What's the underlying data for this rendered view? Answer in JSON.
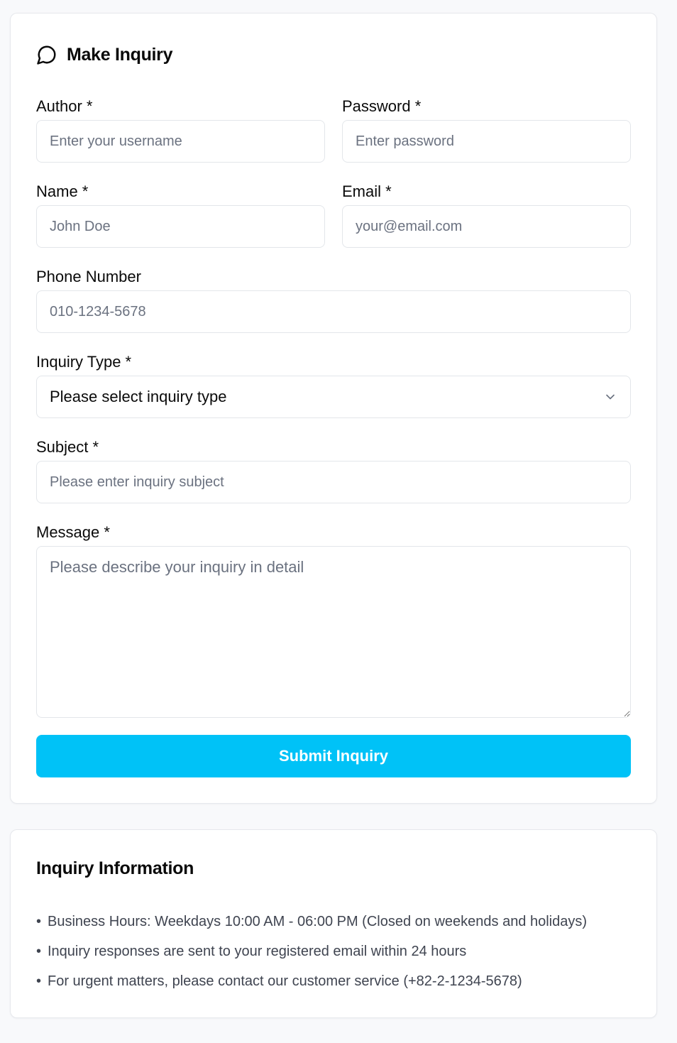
{
  "inquiry_form": {
    "title": "Make Inquiry",
    "title_icon": "message-circle-icon",
    "author": {
      "label": "Author *",
      "placeholder": "Enter your username"
    },
    "password": {
      "label": "Password *",
      "placeholder": "Enter password"
    },
    "name": {
      "label": "Name *",
      "placeholder": "John Doe"
    },
    "email": {
      "label": "Email *",
      "placeholder": "your@email.com"
    },
    "phone": {
      "label": "Phone Number",
      "placeholder": "010-1234-5678"
    },
    "inquiry_type": {
      "label": "Inquiry Type *",
      "selected": "Please select inquiry type",
      "icon": "chevron-down-icon"
    },
    "subject": {
      "label": "Subject *",
      "placeholder": "Please enter inquiry subject"
    },
    "message": {
      "label": "Message *",
      "placeholder": "Please describe your inquiry in detail"
    },
    "submit_label": "Submit Inquiry"
  },
  "info": {
    "title": "Inquiry Information",
    "items": [
      "Business Hours: Weekdays 10:00 AM - 06:00 PM (Closed on weekends and holidays)",
      "Inquiry responses are sent to your registered email within 24 hours",
      "For urgent matters, please contact our customer service (+82-2-1234-5678)"
    ]
  },
  "colors": {
    "accent": "#00c2f7",
    "page_bg": "#f8f9fb",
    "border": "#e3e6ea",
    "muted_text": "#6b7280"
  }
}
